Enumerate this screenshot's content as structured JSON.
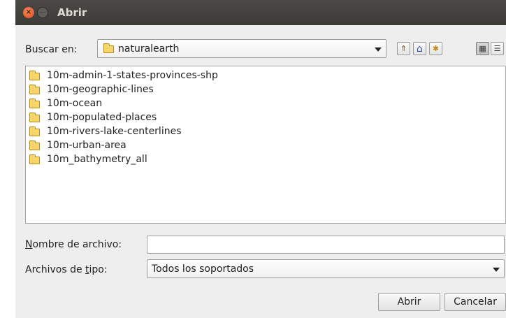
{
  "window": {
    "title": "Abrir",
    "close_glyph": "×",
    "min_glyph": "—"
  },
  "lookin": {
    "label": "Buscar en:",
    "value": "naturalearth"
  },
  "toolbar": {
    "up_glyph": "⇑",
    "home_glyph": "⌂",
    "newfolder_glyph": "✱",
    "list_view_glyph": "▦",
    "details_view_glyph": "☰"
  },
  "files": [
    {
      "name": "10m-admin-1-states-provinces-shp"
    },
    {
      "name": "10m-geographic-lines"
    },
    {
      "name": "10m-ocean"
    },
    {
      "name": "10m-populated-places"
    },
    {
      "name": "10m-rivers-lake-centerlines"
    },
    {
      "name": "10m-urban-area"
    },
    {
      "name": "10m_bathymetry_all"
    }
  ],
  "filename": {
    "label_mnemonic": "N",
    "label_rest": "ombre de archivo:",
    "value": ""
  },
  "filetype": {
    "label_pre": "Archivos de ",
    "label_mnemonic": "t",
    "label_post": "ipo:",
    "value": "Todos los soportados"
  },
  "buttons": {
    "open": "Abrir",
    "cancel": "Cancelar"
  }
}
